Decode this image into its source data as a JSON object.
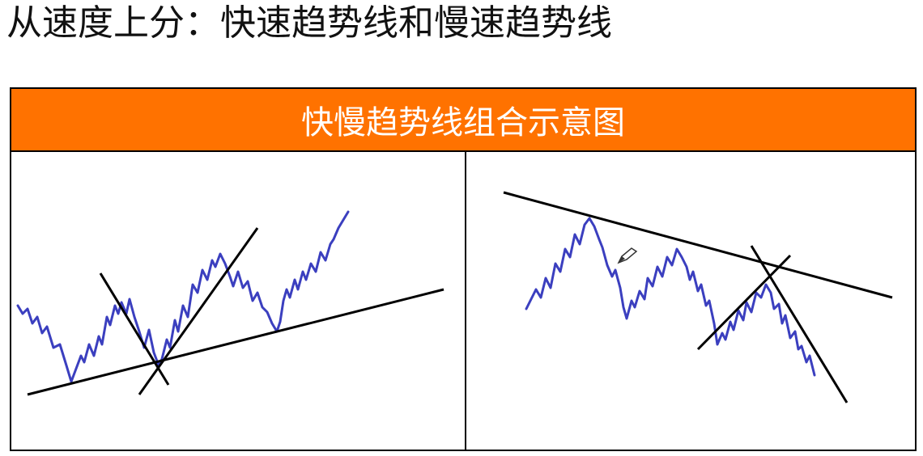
{
  "slide": {
    "title": "从速度上分：快速趋势线和慢速趋势线"
  },
  "diagram": {
    "header": "快慢趋势线组合示意图",
    "colors": {
      "header_background": "#ff7200",
      "price_line": "#3b3fbf",
      "trend_line": "#000000"
    },
    "panels": [
      {
        "id": "uptrend-combination",
        "trend_lines": [
          "slow-support",
          "fast-down",
          "fast-up"
        ]
      },
      {
        "id": "downtrend-combination",
        "trend_lines": [
          "slow-resistance",
          "fast-up",
          "fast-down"
        ]
      }
    ]
  }
}
